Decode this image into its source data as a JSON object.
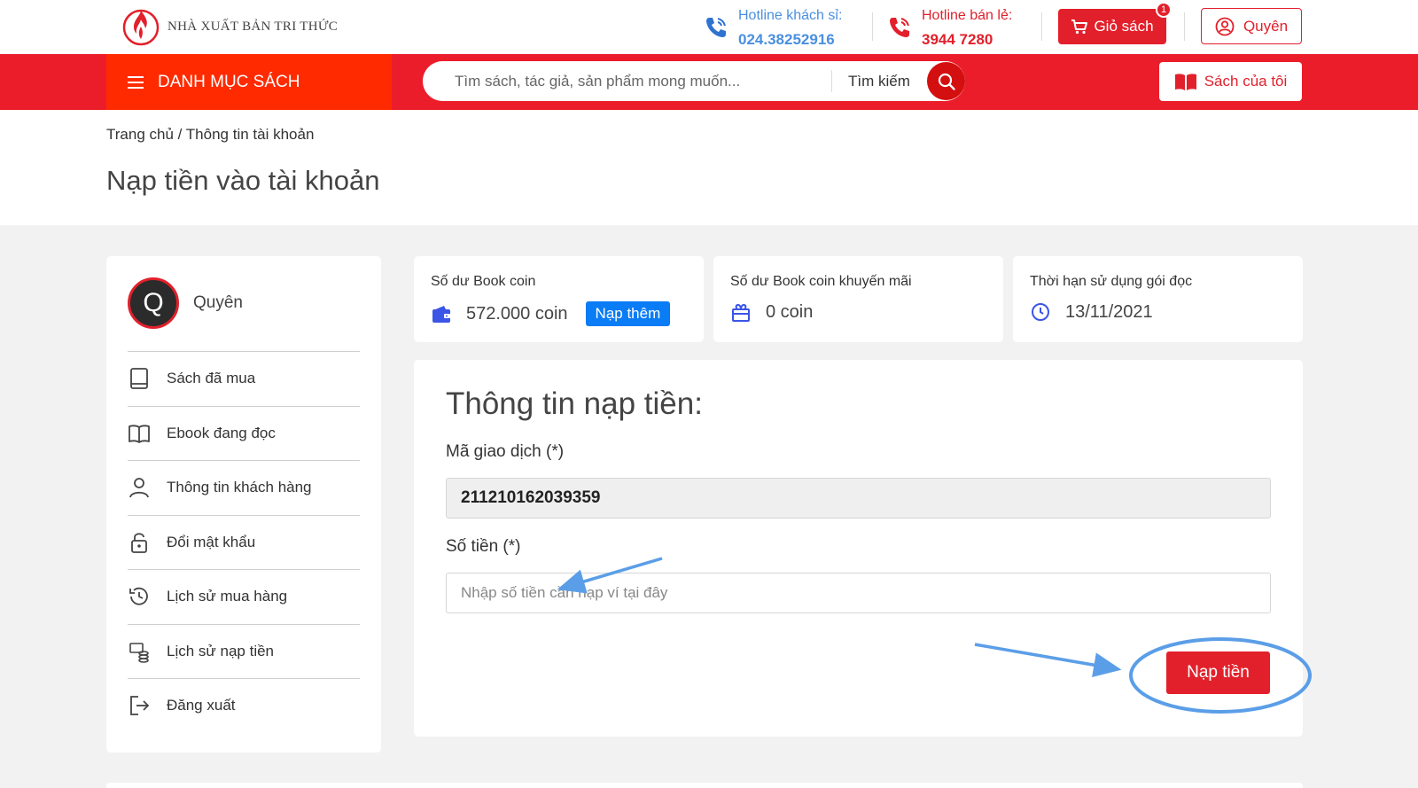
{
  "brand": {
    "name": "NHÀ XUẤT BẢN TRI THỨC"
  },
  "header": {
    "hotline_wholesale": {
      "label": "Hotline khách sỉ:",
      "number": "024.38252916"
    },
    "hotline_retail": {
      "label": "Hotline bán lẻ:",
      "number": "3944 7280"
    },
    "cart": {
      "label": "Giỏ sách",
      "count": "1"
    },
    "user": {
      "label": "Quyên"
    }
  },
  "nav": {
    "category_label": "DANH MỤC SÁCH",
    "search": {
      "placeholder": "Tìm sách, tác giả, sản phẩm mong muốn...",
      "button_label": "Tìm kiếm"
    },
    "my_books_label": "Sách của tôi"
  },
  "breadcrumb": {
    "home": "Trang chủ",
    "separator": " / ",
    "current": "Thông tin tài khoản"
  },
  "page_title": "Nạp tiền vào tài khoản",
  "sidebar": {
    "avatar_initial": "Q",
    "user_name": "Quyên",
    "items": [
      {
        "label": "Sách đã mua",
        "icon": "book-icon"
      },
      {
        "label": "Ebook đang đọc",
        "icon": "open-book-icon"
      },
      {
        "label": "Thông tin khách hàng",
        "icon": "user-icon"
      },
      {
        "label": "Đổi mật khẩu",
        "icon": "lock-icon"
      },
      {
        "label": "Lịch sử mua hàng",
        "icon": "history-icon"
      },
      {
        "label": "Lịch sử nạp tiền",
        "icon": "coins-icon"
      },
      {
        "label": "Đăng xuất",
        "icon": "logout-icon"
      }
    ]
  },
  "stats": {
    "coin_balance": {
      "title": "Số dư Book coin",
      "value": "572.000 coin",
      "action_label": "Nạp thêm",
      "icon": "wallet-icon"
    },
    "promo_balance": {
      "title": "Số dư Book coin khuyến mãi",
      "value": "0 coin",
      "icon": "gift-icon"
    },
    "reading_expiry": {
      "title": "Thời hạn sử dụng gói đọc",
      "value": "13/11/2021",
      "icon": "clock-icon"
    }
  },
  "form": {
    "title": "Thông tin nạp tiền:",
    "transaction_label": "Mã giao dịch (*)",
    "transaction_value": "211210162039359",
    "amount_label": "Số tiền (*)",
    "amount_placeholder": "Nhập số tiền cần nạp ví tại đây",
    "amount_value": "",
    "submit_label": "Nạp tiền"
  },
  "colors": {
    "brand_red": "#ec1d2a",
    "category_orange_red": "#ff2a00",
    "hotline_blue": "#4a8fe0",
    "action_blue": "#0a7cf5",
    "annotation_blue": "#5b9ee8"
  }
}
